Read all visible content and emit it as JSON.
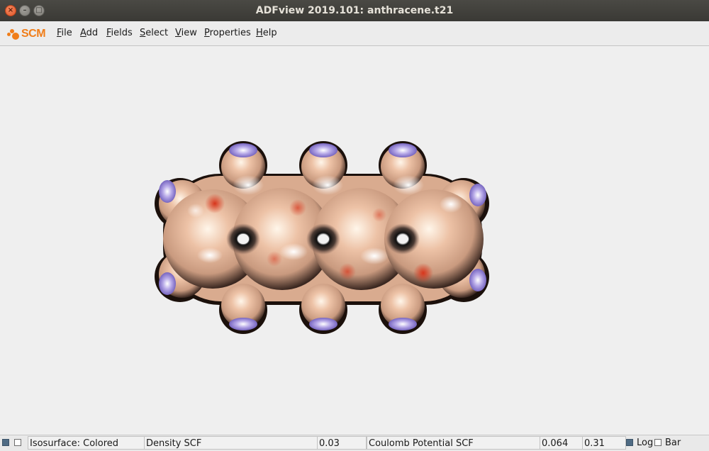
{
  "window": {
    "title": "ADFview 2019.101: anthracene.t21",
    "close_glyph": "×",
    "minimize_glyph": "–",
    "maximize_glyph": "□"
  },
  "menubar": {
    "logo_text": "SCM",
    "items": [
      {
        "label": "File",
        "mnemonic": "F",
        "rest": "ile"
      },
      {
        "label": "Add",
        "mnemonic": "A",
        "rest": "dd"
      },
      {
        "label": "Fields",
        "mnemonic": "F",
        "rest": "ields"
      },
      {
        "label": "Select",
        "mnemonic": "S",
        "rest": "elect"
      },
      {
        "label": "View",
        "mnemonic": "V",
        "rest": "iew"
      },
      {
        "label": "Properties",
        "mnemonic": "P",
        "rest": "roperties"
      },
      {
        "label": "Help",
        "mnemonic": "H",
        "rest": "elp"
      }
    ]
  },
  "viewport": {
    "molecule": "anthracene",
    "surface_colors": {
      "base": "#e8b59a",
      "highlight": "#fff4e6",
      "negative": "#d93a1e",
      "positive": "#8f7ad6",
      "shadow": "#1a0f0a"
    }
  },
  "statusbar": {
    "visible_checked": true,
    "second_checked": false,
    "isosurface_label": "Isosurface: Colored",
    "field": "Density SCF",
    "iso_value": "0.03",
    "color_field": "Coulomb Potential SCF",
    "range_min": "0.064",
    "range_max": "0.31",
    "log_checked": true,
    "log_label": "Log",
    "bar_checked": false,
    "bar_label": "Bar"
  }
}
